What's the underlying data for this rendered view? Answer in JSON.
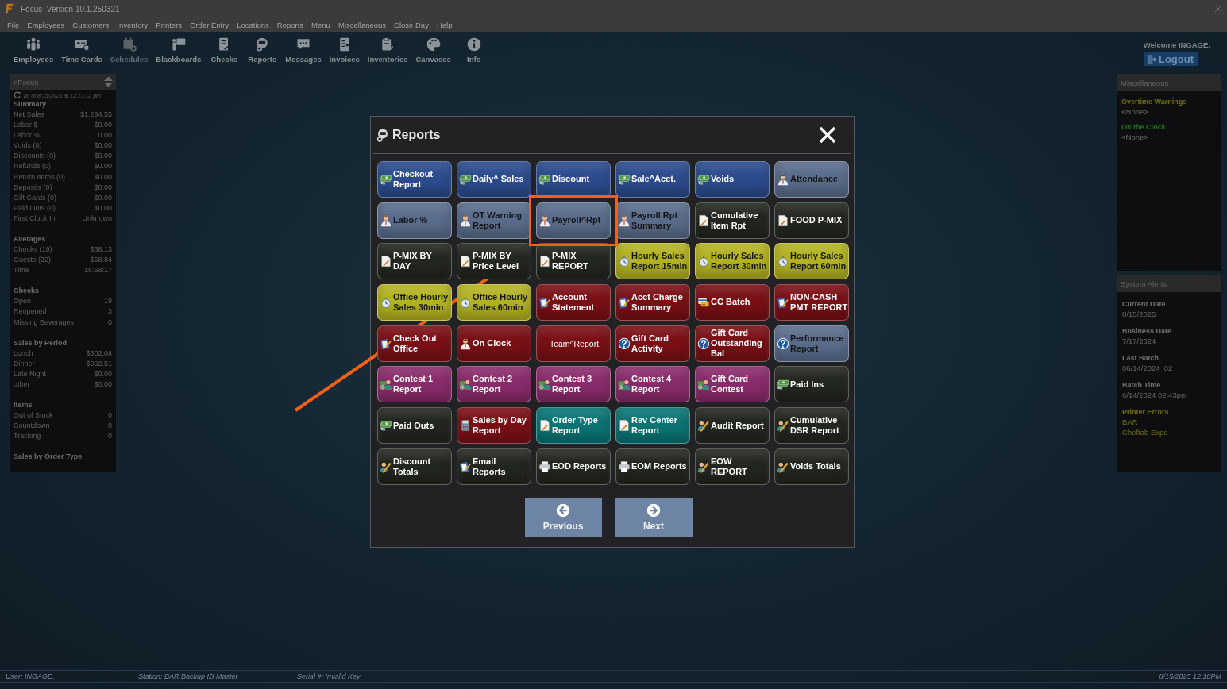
{
  "window": {
    "title": "Focus  Version 10.1.250321"
  },
  "menu": [
    "File",
    "Employees",
    "Customers",
    "Inventory",
    "Printers",
    "Order Entry",
    "Locations",
    "Reports",
    "Menu",
    "Miscellaneous",
    "Close Day",
    "Help"
  ],
  "toolbar": {
    "items": [
      {
        "label": "Employees",
        "disabled": false
      },
      {
        "label": "Time Cards",
        "disabled": false
      },
      {
        "label": "Schedules",
        "disabled": true
      },
      {
        "label": "Blackboards",
        "disabled": false
      },
      {
        "label": "Checks",
        "disabled": false
      },
      {
        "label": "Reports",
        "disabled": false
      },
      {
        "label": "Messages",
        "disabled": false
      },
      {
        "label": "Invoices",
        "disabled": false
      },
      {
        "label": "Inventories",
        "disabled": false
      },
      {
        "label": "Canvases",
        "disabled": false
      },
      {
        "label": "Info",
        "disabled": false
      }
    ],
    "welcome": "Welcome INGAGE.",
    "logout": "Logout"
  },
  "left_panel": {
    "title": "nFocus",
    "timestamp": "as of 8/15/2025 at 12:17:12 pm",
    "sections": [
      {
        "title": "Summary",
        "rows": [
          {
            "label": "Net Sales",
            "value": "$1,294.55"
          },
          {
            "label": "Labor $",
            "value": "$0.00"
          },
          {
            "label": "Labor %",
            "value": "0.00"
          },
          {
            "label": "Voids (0)",
            "value": "$0.00"
          },
          {
            "label": "Discounts (0)",
            "value": "$0.00"
          },
          {
            "label": "Refunds (0)",
            "value": "$0.00"
          },
          {
            "label": "Return Items (0)",
            "value": "$0.00"
          },
          {
            "label": "Deposits (0)",
            "value": "$0.00"
          },
          {
            "label": "Gift Cards (0)",
            "value": "$0.00"
          },
          {
            "label": "Paid Outs (0)",
            "value": "$0.00"
          },
          {
            "label": "First Clock In",
            "value": "Unknown"
          }
        ]
      },
      {
        "title": "Averages",
        "rows": [
          {
            "label": "Checks (19)",
            "value": "$68.13"
          },
          {
            "label": "Guests (22)",
            "value": "$58.84"
          },
          {
            "label": "Time",
            "value": "16:58:17"
          }
        ]
      },
      {
        "title": "Checks",
        "rows": [
          {
            "label": "Open",
            "value": "19"
          },
          {
            "label": "Reopened",
            "value": "3"
          },
          {
            "label": "Missing Beverages",
            "value": "0"
          }
        ]
      },
      {
        "title": "Sales by Period",
        "rows": [
          {
            "label": "Lunch",
            "value": "$302.04"
          },
          {
            "label": "Dinner",
            "value": "$992.51"
          },
          {
            "label": "Late Night",
            "value": "$0.00"
          },
          {
            "label": "other",
            "value": "$0.00"
          }
        ]
      },
      {
        "title": "Items",
        "rows": [
          {
            "label": "Out of Stock",
            "value": "0"
          },
          {
            "label": "Countdown",
            "value": "0"
          },
          {
            "label": "Tracking",
            "value": "0"
          }
        ]
      },
      {
        "title": "Sales by Order Type"
      }
    ]
  },
  "right_panel": {
    "sections": [
      {
        "title": "Miscellaneous",
        "items": [
          {
            "label": "Overtime Warnings",
            "color": "#6f6f10",
            "values": [
              {
                "text": "<None>"
              }
            ]
          },
          {
            "label": "On the Clock",
            "color": "#1d6e1d",
            "values": [
              {
                "text": "<None>"
              }
            ]
          }
        ]
      },
      {
        "title": "System Alerts",
        "items": [
          {
            "label": "Current Date",
            "color": "#707070",
            "values": [
              {
                "text": "8/15/2025",
                "color": "#666666"
              }
            ]
          },
          {
            "label": "Business Date",
            "color": "#707070",
            "values": [
              {
                "text": "7/17/2024",
                "color": "#666666"
              }
            ]
          },
          {
            "label": "Last Batch",
            "color": "#707070",
            "values": [
              {
                "text": "06/14/2024 .02",
                "color": "#666666"
              }
            ]
          },
          {
            "label": "Batch Time",
            "color": "#707070",
            "values": [
              {
                "text": "6/14/2024 02:43pm",
                "color": "#666666"
              }
            ]
          },
          {
            "label": "Printer Errors",
            "color": "#6f6f10",
            "values": [
              {
                "text": "BAR",
                "color": "#6f6f10"
              },
              {
                "text": "Cheftab Expo",
                "color": "#6f6f10"
              }
            ]
          }
        ]
      }
    ]
  },
  "dialog": {
    "title": "Reports",
    "buttons": [
      {
        "label": "Checkout Report",
        "kind": "money",
        "color": "#2c4c8e",
        "bold": true,
        "highlighted": false
      },
      {
        "label": "Daily^ Sales",
        "kind": "money",
        "color": "#2c4c8e",
        "bold": true,
        "highlighted": false
      },
      {
        "label": "Discount",
        "kind": "money",
        "color": "#2c4c8e",
        "bold": true,
        "highlighted": false
      },
      {
        "label": "Sale^Acct.",
        "kind": "money",
        "color": "#2c4c8e",
        "bold": true,
        "highlighted": false
      },
      {
        "label": "Voids",
        "kind": "money",
        "color": "#2c4c8e",
        "bold": true,
        "highlighted": false
      },
      {
        "label": "Attendance",
        "kind": "person",
        "color": "#5a6d8c",
        "bold": true,
        "highlighted": false
      },
      {
        "label": "Labor %",
        "kind": "person",
        "color": "#5a6d8c",
        "bold": true,
        "highlighted": false
      },
      {
        "label": "OT Warning Report",
        "kind": "person",
        "color": "#5a6d8c",
        "bold": true,
        "highlighted": false
      },
      {
        "label": "Payroll^Rpt",
        "kind": "person",
        "color": "#5a6d8c",
        "bold": true,
        "highlighted": true
      },
      {
        "label": "Payroll Rpt Summary",
        "kind": "person",
        "color": "#5a6d8c",
        "bold": true,
        "highlighted": false
      },
      {
        "label": "Cumulative Item Rpt",
        "kind": "document",
        "color": "#22271f",
        "bold": true,
        "highlighted": false
      },
      {
        "label": "FOOD P-MIX",
        "kind": "document",
        "color": "#22271f",
        "bold": true,
        "highlighted": false
      },
      {
        "label": "P-MIX BY DAY",
        "kind": "document",
        "color": "#22271f",
        "bold": true,
        "highlighted": false
      },
      {
        "label": "P-MIX BY Price Level",
        "kind": "document",
        "color": "#22271f",
        "bold": true,
        "highlighted": false
      },
      {
        "label": "P-MIX REPORT",
        "kind": "document",
        "color": "#22271f",
        "bold": true,
        "highlighted": false
      },
      {
        "label": "Hourly Sales Report 15min",
        "kind": "stopwatch",
        "color": "#b3b322",
        "bold": true,
        "highlighted": false
      },
      {
        "label": "Hourly Sales Report 30min",
        "kind": "stopwatch",
        "color": "#b3b322",
        "bold": true,
        "highlighted": false
      },
      {
        "label": "Hourly Sales Report 60min",
        "kind": "stopwatch",
        "color": "#b3b322",
        "bold": true,
        "highlighted": false
      },
      {
        "label": "Office Hourly Sales 30min",
        "kind": "stopwatch",
        "color": "#b3b322",
        "bold": true,
        "highlighted": false
      },
      {
        "label": "Office Hourly Sales 60min",
        "kind": "stopwatch",
        "color": "#b3b322",
        "bold": true,
        "highlighted": false
      },
      {
        "label": "Account Statement",
        "kind": "clipboard",
        "color": "#7a1016",
        "bold": true,
        "highlighted": false
      },
      {
        "label": "Acct Charge Summary",
        "kind": "clipboard",
        "color": "#7a1016",
        "bold": true,
        "highlighted": false
      },
      {
        "label": "CC Batch",
        "kind": "card",
        "color": "#7a1016",
        "bold": true,
        "highlighted": false
      },
      {
        "label": "NON-CASH PMT REPORT",
        "kind": "clipboard",
        "color": "#7a1016",
        "bold": true,
        "highlighted": false
      },
      {
        "label": "Check Out Office",
        "kind": "clipboard",
        "color": "#7a1016",
        "bold": true,
        "highlighted": false
      },
      {
        "label": "On Clock",
        "kind": "person",
        "color": "#7a1016",
        "bold": true,
        "highlighted": false
      },
      {
        "label": "Team^Report",
        "kind": "none",
        "color": "#7a1016",
        "bold": false,
        "highlighted": false
      },
      {
        "label": "Gift Card Activity",
        "kind": "help",
        "color": "#7a1016",
        "bold": true,
        "highlighted": false
      },
      {
        "label": "Gift Card Outstanding Bal",
        "kind": "help",
        "color": "#7a1016",
        "bold": true,
        "highlighted": false
      },
      {
        "label": "Performance Report",
        "kind": "help",
        "color": "#5a6d8c",
        "bold": true,
        "highlighted": false
      },
      {
        "label": "Contest 1 Report",
        "kind": "contest",
        "color": "#8a2c6c",
        "bold": true,
        "highlighted": false
      },
      {
        "label": "Contest 2 Report",
        "kind": "contest",
        "color": "#8a2c6c",
        "bold": true,
        "highlighted": false
      },
      {
        "label": "Contest 3 Report",
        "kind": "contest",
        "color": "#8a2c6c",
        "bold": true,
        "highlighted": false
      },
      {
        "label": "Contest 4 Report",
        "kind": "contest",
        "color": "#8a2c6c",
        "bold": true,
        "highlighted": false
      },
      {
        "label": "Gift Card Contest",
        "kind": "contest",
        "color": "#8a2c6c",
        "bold": true,
        "highlighted": false
      },
      {
        "label": "Paid Ins",
        "kind": "money",
        "color": "#22271f",
        "bold": true,
        "highlighted": false
      },
      {
        "label": "Paid Outs",
        "kind": "money",
        "color": "#22271f",
        "bold": true,
        "highlighted": false
      },
      {
        "label": "Sales by Day Report",
        "kind": "calculator",
        "color": "#7a1016",
        "bold": true,
        "highlighted": false
      },
      {
        "label": "Order Type Report",
        "kind": "document",
        "color": "#0b7474",
        "bold": true,
        "highlighted": false
      },
      {
        "label": "Rev Center Report",
        "kind": "document",
        "color": "#0b7474",
        "bold": true,
        "highlighted": false
      },
      {
        "label": "Audit Report",
        "kind": "pencil",
        "color": "#22271f",
        "bold": true,
        "highlighted": false
      },
      {
        "label": "Cumulative DSR Report",
        "kind": "pencil",
        "color": "#22271f",
        "bold": true,
        "highlighted": false
      },
      {
        "label": "Discount Totals",
        "kind": "pencil",
        "color": "#22271f",
        "bold": true,
        "highlighted": false
      },
      {
        "label": "Email Reports",
        "kind": "clipboard",
        "color": "#22271f",
        "bold": true,
        "highlighted": false
      },
      {
        "label": "EOD Reports",
        "kind": "printer",
        "color": "#22271f",
        "bold": true,
        "highlighted": false
      },
      {
        "label": "EOM Reports",
        "kind": "printer",
        "color": "#22271f",
        "bold": true,
        "highlighted": false
      },
      {
        "label": "EOW REPORT",
        "kind": "pencil",
        "color": "#22271f",
        "bold": true,
        "highlighted": false
      },
      {
        "label": "Voids Totals",
        "kind": "pencil",
        "color": "#22271f",
        "bold": true,
        "highlighted": false
      }
    ],
    "nav": [
      {
        "label": "Previous",
        "kind": "previous"
      },
      {
        "label": "Next",
        "kind": "next"
      }
    ]
  },
  "status_bar": {
    "user": "User: INGAGE.",
    "station": "Station: BAR Backup ID Master",
    "serial": "Serial #: Invalid Key",
    "datetime": "8/15/2025 12:18PM"
  }
}
